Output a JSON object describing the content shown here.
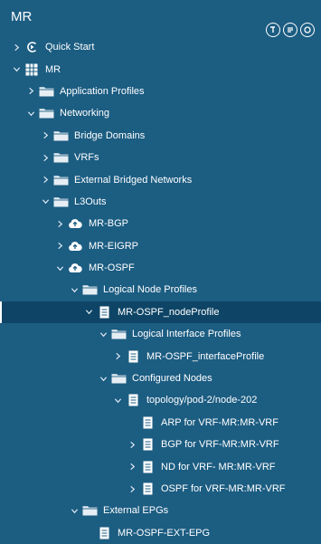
{
  "panel": {
    "title": "MR",
    "header_icons": [
      "panel-tool-icon",
      "panel-list-icon",
      "panel-refresh-icon"
    ]
  },
  "tree": [
    {
      "label": "Quick Start",
      "depth": 0,
      "expander": "collapsed",
      "icon": "quick-start"
    },
    {
      "label": "MR",
      "depth": 0,
      "expander": "expanded",
      "icon": "tenant"
    },
    {
      "label": "Application Profiles",
      "depth": 1,
      "expander": "collapsed",
      "icon": "folder"
    },
    {
      "label": "Networking",
      "depth": 1,
      "expander": "expanded",
      "icon": "folder"
    },
    {
      "label": "Bridge Domains",
      "depth": 2,
      "expander": "collapsed",
      "icon": "folder"
    },
    {
      "label": "VRFs",
      "depth": 2,
      "expander": "collapsed",
      "icon": "folder"
    },
    {
      "label": "External Bridged Networks",
      "depth": 2,
      "expander": "collapsed",
      "icon": "folder"
    },
    {
      "label": "L3Outs",
      "depth": 2,
      "expander": "expanded",
      "icon": "folder"
    },
    {
      "label": "MR-BGP",
      "depth": 3,
      "expander": "collapsed",
      "icon": "cloud"
    },
    {
      "label": "MR-EIGRP",
      "depth": 3,
      "expander": "collapsed",
      "icon": "cloud"
    },
    {
      "label": "MR-OSPF",
      "depth": 3,
      "expander": "expanded",
      "icon": "cloud"
    },
    {
      "label": "Logical Node Profiles",
      "depth": 4,
      "expander": "expanded",
      "icon": "folder"
    },
    {
      "label": "MR-OSPF_nodeProfile",
      "depth": 5,
      "expander": "expanded",
      "icon": "doc",
      "selected": true
    },
    {
      "label": "Logical Interface Profiles",
      "depth": 6,
      "expander": "expanded",
      "icon": "folder"
    },
    {
      "label": "MR-OSPF_interfaceProfile",
      "depth": 7,
      "expander": "collapsed",
      "icon": "doc"
    },
    {
      "label": "Configured Nodes",
      "depth": 6,
      "expander": "expanded",
      "icon": "folder"
    },
    {
      "label": "topology/pod-2/node-202",
      "depth": 7,
      "expander": "expanded",
      "icon": "doc"
    },
    {
      "label": "ARP for VRF-MR:MR-VRF",
      "depth": 8,
      "expander": "none",
      "icon": "doc"
    },
    {
      "label": "BGP for VRF-MR:MR-VRF",
      "depth": 8,
      "expander": "collapsed",
      "icon": "doc"
    },
    {
      "label": "ND for VRF- MR:MR-VRF",
      "depth": 8,
      "expander": "collapsed",
      "icon": "doc"
    },
    {
      "label": "OSPF for VRF-MR:MR-VRF",
      "depth": 8,
      "expander": "collapsed",
      "icon": "doc"
    },
    {
      "label": "External EPGs",
      "depth": 4,
      "expander": "expanded",
      "icon": "folder"
    },
    {
      "label": "MR-OSPF-EXT-EPG",
      "depth": 5,
      "expander": "none",
      "icon": "doc"
    }
  ],
  "colors": {
    "background": "#1c5d82",
    "selected": "#0e4566",
    "text": "#ffffff"
  }
}
